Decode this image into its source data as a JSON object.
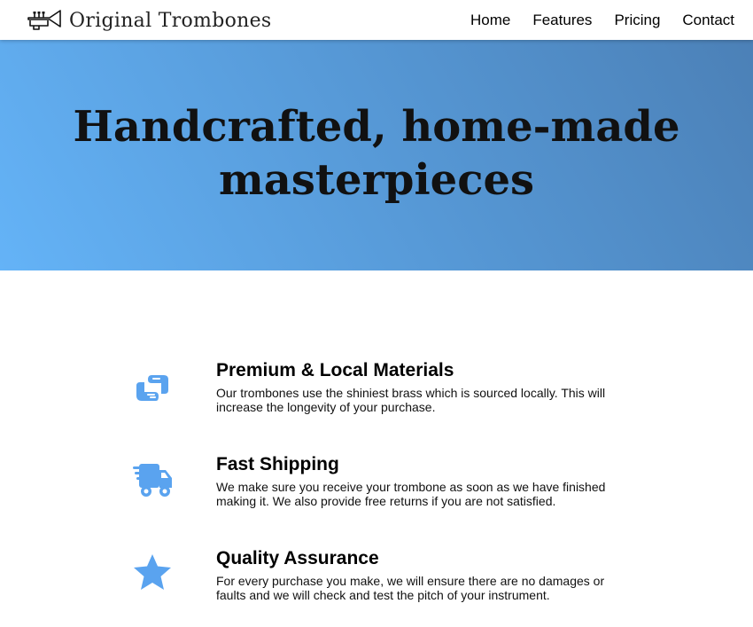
{
  "brand": {
    "name": "Original Trombones",
    "logo_icon": "trumpet-icon"
  },
  "nav": {
    "items": [
      {
        "label": "Home"
      },
      {
        "label": "Features"
      },
      {
        "label": "Pricing"
      },
      {
        "label": "Contact"
      }
    ]
  },
  "hero": {
    "title": "Handcrafted, home-made masterpieces",
    "gradient": [
      "#64b3f7",
      "#4b7fb5"
    ]
  },
  "features": [
    {
      "icon": "handshake-icon",
      "title": "Premium & Local Materials",
      "description": "Our trombones use the shiniest brass which is sourced locally. This will increase the longevity of your purchase."
    },
    {
      "icon": "shipping-truck-icon",
      "title": "Fast Shipping",
      "description": "We make sure you receive your trombone as soon as we have finished making it. We also provide free returns if you are not satisfied."
    },
    {
      "icon": "star-icon",
      "title": "Quality Assurance",
      "description": "For every purchase you make, we will ensure there are no damages or faults and we will check and test the pitch of your instrument."
    }
  ],
  "colors": {
    "accent": "#5aa3ef",
    "header_bg": "#ffffff",
    "text": "#111111"
  }
}
